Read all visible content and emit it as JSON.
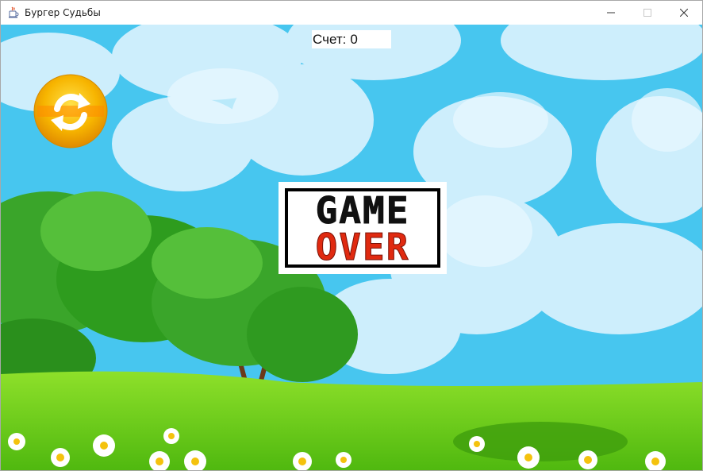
{
  "window": {
    "title": "Бургер Судьбы",
    "icon": "java-cup-icon",
    "controls": [
      "minimize-icon",
      "maximize-icon",
      "close-icon"
    ]
  },
  "hud": {
    "score_label": "Счет:",
    "score_value": "0"
  },
  "restart": {
    "icon": "refresh-icon",
    "colors": {
      "outer": "#f7b500",
      "inner": "#ff8a00",
      "arrows": "#ffffff"
    }
  },
  "game_over": {
    "line1": "GAME",
    "line2": "OVER",
    "colors": {
      "line1": "#111111",
      "line2": "#e02a10"
    }
  },
  "scene": {
    "sky": "#47c6ef",
    "clouds": "#cdeefc",
    "grass": "#5fcf1d",
    "trees": "#2e9c1e"
  }
}
